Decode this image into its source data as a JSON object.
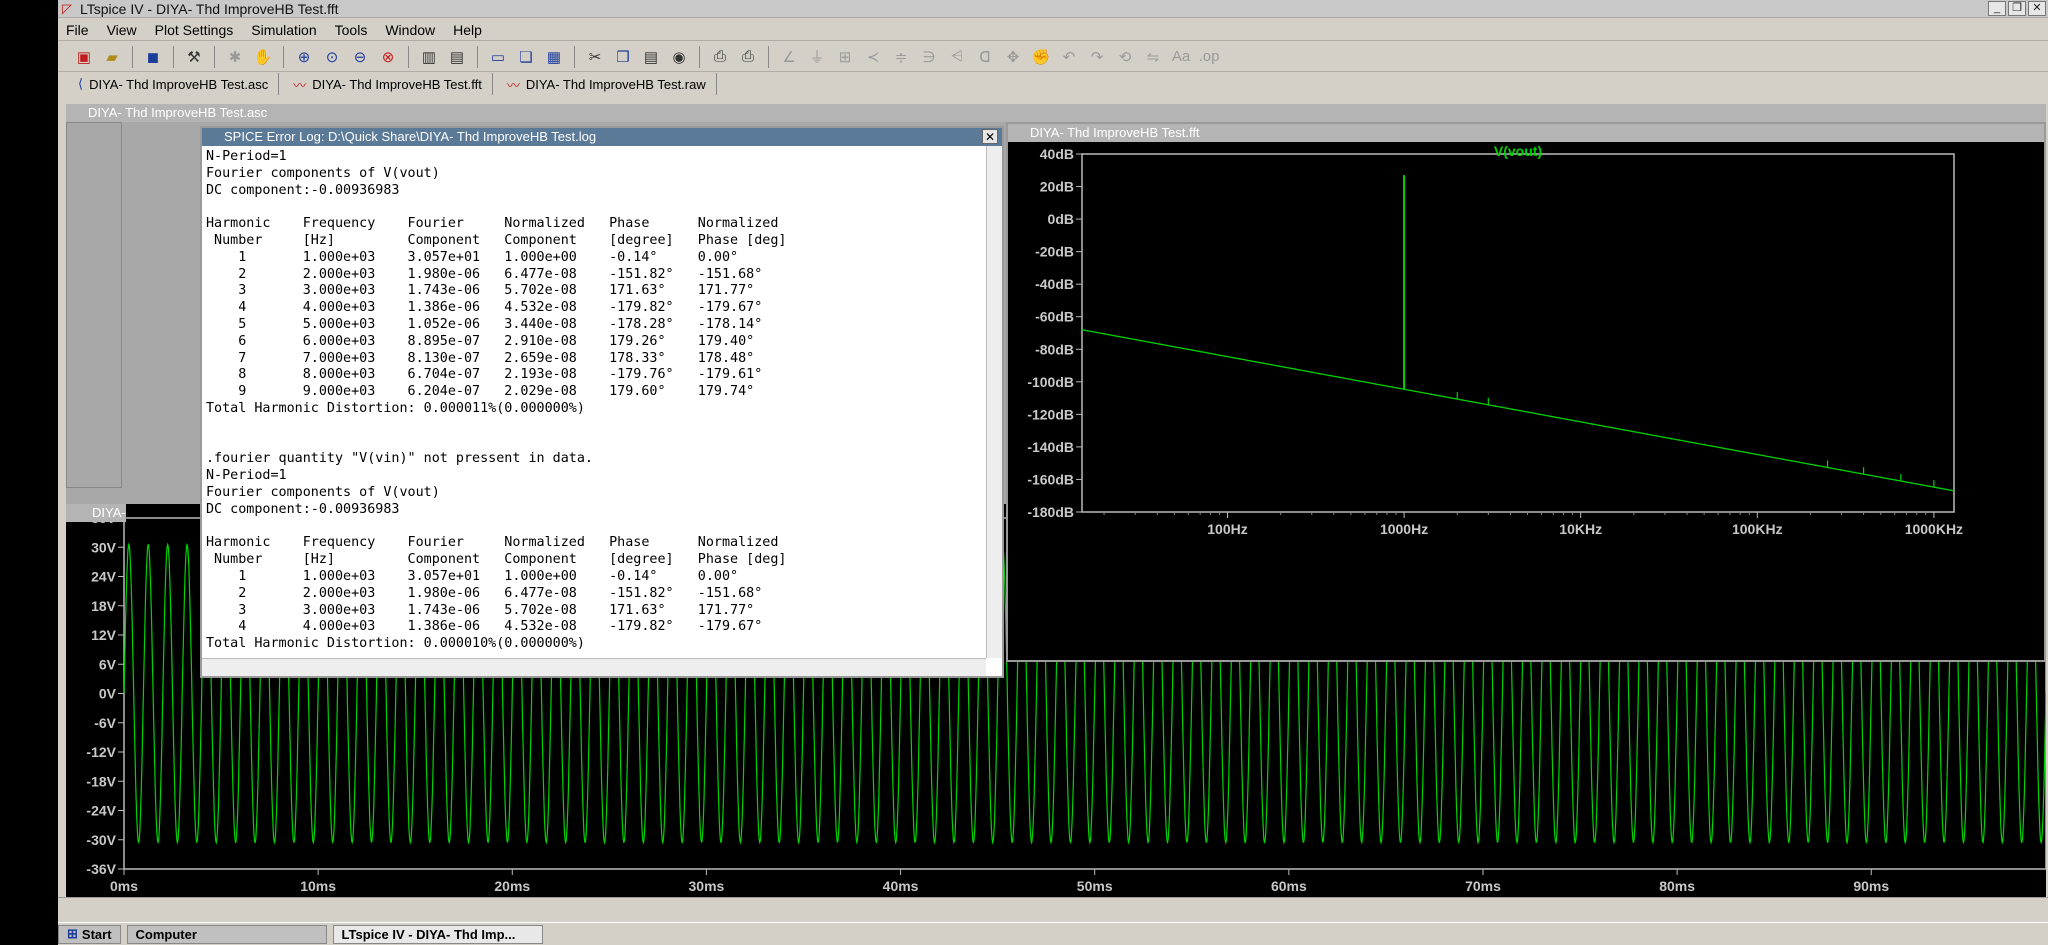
{
  "window": {
    "title": "LTspice IV - DIYA- Thd ImproveHB Test.fft"
  },
  "menu": [
    "File",
    "View",
    "Plot Settings",
    "Simulation",
    "Tools",
    "Window",
    "Help"
  ],
  "tabs": [
    {
      "label": "DIYA- Thd ImproveHB Test.asc",
      "icon": "schematic-icon"
    },
    {
      "label": "DIYA- Thd ImproveHB Test.fft",
      "icon": "waveform-icon"
    },
    {
      "label": "DIYA- Thd ImproveHB Test.raw",
      "icon": "waveform-icon"
    }
  ],
  "schematic_window": {
    "title": "DIYA- Thd ImproveHB Test.asc"
  },
  "transient_window": {
    "title": "DIYA-"
  },
  "log_window": {
    "title": "SPICE Error Log: D:\\Quick Share\\DIYA- Thd ImproveHB Test.log",
    "lines": [
      "N-Period=1",
      "Fourier components of V(vout)",
      "DC component:-0.00936983",
      "",
      "Harmonic    Frequency    Fourier     Normalized   Phase      Normalized",
      " Number     [Hz]         Component   Component    [degree]   Phase [deg]",
      "    1       1.000e+03    3.057e+01   1.000e+00    -0.14°     0.00°",
      "    2       2.000e+03    1.980e-06   6.477e-08    -151.82°   -151.68°",
      "    3       3.000e+03    1.743e-06   5.702e-08    171.63°    171.77°",
      "    4       4.000e+03    1.386e-06   4.532e-08    -179.82°   -179.67°",
      "    5       5.000e+03    1.052e-06   3.440e-08    -178.28°   -178.14°",
      "    6       6.000e+03    8.895e-07   2.910e-08    179.26°    179.40°",
      "    7       7.000e+03    8.130e-07   2.659e-08    178.33°    178.48°",
      "    8       8.000e+03    6.704e-07   2.193e-08    -179.76°   -179.61°",
      "    9       9.000e+03    6.204e-07   2.029e-08    179.60°    179.74°",
      "Total Harmonic Distortion: 0.000011%(0.000000%)",
      "",
      "",
      ".fourier quantity \"V(vin)\" not pressent in data.",
      "N-Period=1",
      "Fourier components of V(vout)",
      "DC component:-0.00936983",
      "",
      "Harmonic    Frequency    Fourier     Normalized   Phase      Normalized",
      " Number     [Hz]         Component   Component    [degree]   Phase [deg]",
      "    1       1.000e+03    3.057e+01   1.000e+00    -0.14°     0.00°",
      "    2       2.000e+03    1.980e-06   6.477e-08    -151.82°   -151.68°",
      "    3       3.000e+03    1.743e-06   5.702e-08    171.63°    171.77°",
      "    4       4.000e+03    1.386e-06   4.532e-08    -179.82°   -179.67°",
      "Total Harmonic Distortion: 0.000010%(0.000000%)"
    ]
  },
  "fft_window": {
    "title": "DIYA- Thd ImproveHB Test.fft"
  },
  "taskbar": {
    "start": "Start",
    "computer": "Computer",
    "task": "LTspice IV - DIYA- Thd Imp..."
  },
  "colors": {
    "trace": "#00d400",
    "plot_bg": "#000000",
    "axis": "#c8c8c8",
    "log_title": "#5a7a98"
  },
  "chart_data": [
    {
      "type": "line",
      "title": "V(vout)",
      "xlabel": "",
      "ylabel": "",
      "x_scale": "log",
      "x_ticks": [
        "100Hz",
        "1000Hz",
        "10KHz",
        "100KHz",
        "1000KHz"
      ],
      "y_ticks": [
        "40dB",
        "20dB",
        "0dB",
        "-20dB",
        "-40dB",
        "-60dB",
        "-80dB",
        "-100dB",
        "-120dB",
        "-140dB",
        "-160dB",
        "-180dB"
      ],
      "ylim": [
        -180,
        40
      ],
      "xlim_hz": [
        15,
        1300000
      ],
      "series": [
        {
          "name": "V(vout)",
          "noise_floor": {
            "x_hz": [
              15,
              1300000
            ],
            "y_db": [
              -68,
              -167
            ]
          },
          "peaks": [
            {
              "x_hz": 1000,
              "y_db": 27
            }
          ]
        }
      ]
    },
    {
      "type": "line",
      "title": "",
      "xlabel": "",
      "ylabel": "",
      "x_ticks": [
        "0ms",
        "10ms",
        "20ms",
        "30ms",
        "40ms",
        "50ms",
        "60ms",
        "70ms",
        "80ms",
        "90ms"
      ],
      "y_ticks": [
        "36V",
        "30V",
        "24V",
        "18V",
        "12V",
        "6V",
        "0V",
        "-6V",
        "-12V",
        "-18V",
        "-24V",
        "-30V",
        "-36V"
      ],
      "ylim": [
        -36,
        36
      ],
      "xlim_ms": [
        0,
        99
      ],
      "series": [
        {
          "frequency_hz": 1000,
          "amplitude_v": 30.57
        }
      ]
    }
  ]
}
